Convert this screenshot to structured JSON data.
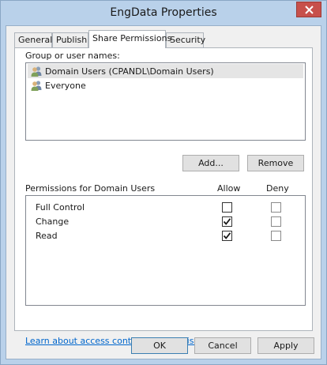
{
  "window": {
    "title": "EngData Properties"
  },
  "tabs": [
    {
      "label": "General",
      "active": false
    },
    {
      "label": "Publish",
      "active": false
    },
    {
      "label": "Share Permissions",
      "active": true
    },
    {
      "label": "Security",
      "active": false
    }
  ],
  "group_section": {
    "label": "Group or user names:",
    "items": [
      {
        "label": "Domain Users (CPANDL\\Domain Users)",
        "icon": "users-icon",
        "selected": true
      },
      {
        "label": "Everyone",
        "icon": "users-icon",
        "selected": false
      }
    ],
    "add_label": "Add...",
    "remove_label": "Remove"
  },
  "permissions": {
    "header_label": "Permissions for Domain Users",
    "allow_label": "Allow",
    "deny_label": "Deny",
    "rows": [
      {
        "name": "Full Control",
        "allow": false,
        "deny": false
      },
      {
        "name": "Change",
        "allow": true,
        "deny": false
      },
      {
        "name": "Read",
        "allow": true,
        "deny": false
      }
    ]
  },
  "link_text": "Learn about access control and permissions",
  "footer": {
    "ok_label": "OK",
    "cancel_label": "Cancel",
    "apply_label": "Apply"
  },
  "colors": {
    "title_bar": "#b9d1ea",
    "close_button": "#c7504b",
    "link": "#0066cc",
    "selection": "#e5e5e5"
  }
}
